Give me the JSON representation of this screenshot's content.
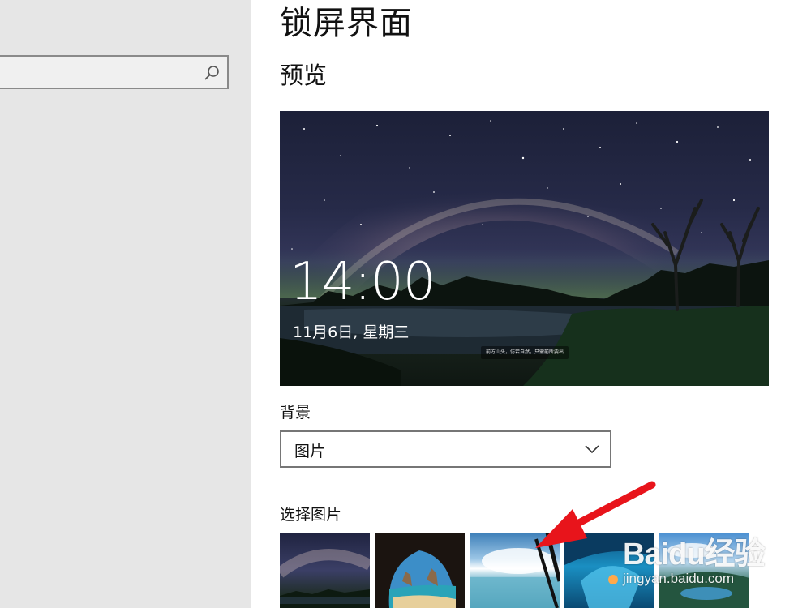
{
  "sidebar": {
    "search": {
      "value": "",
      "placeholder": ""
    }
  },
  "main": {
    "page_title": "锁屏界面",
    "preview_heading": "预览",
    "preview": {
      "time": "14:00",
      "date": "11月6日, 星期三",
      "caption": "前方山头，仿若自然，只需前所要出"
    },
    "background": {
      "label": "背景",
      "selected": "图片"
    },
    "choose_picture": {
      "label": "选择图片",
      "thumbnails": [
        "galaxy-lake",
        "sea-cave-beach",
        "sky-window-sea",
        "blue-ice-cave",
        "lake-island"
      ]
    }
  },
  "watermark": {
    "logo": "Baidu经验",
    "url": "jingyan.baidu.com"
  },
  "colors": {
    "sidebar_bg": "#e6e6e6",
    "arrow": "#e8141b"
  }
}
